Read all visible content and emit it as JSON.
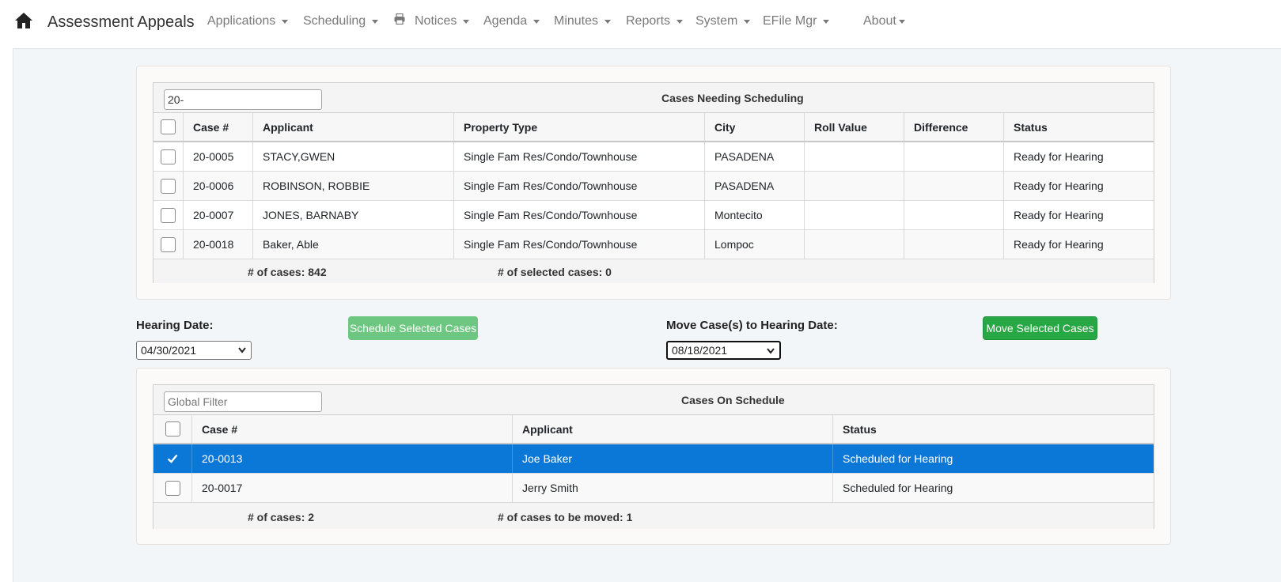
{
  "navbar": {
    "brand": "Assessment Appeals",
    "items": [
      {
        "label": "Applications"
      },
      {
        "label": "Scheduling"
      },
      {
        "label": "Notices"
      },
      {
        "label": "Agenda"
      },
      {
        "label": "Minutes"
      },
      {
        "label": "Reports"
      },
      {
        "label": "System"
      },
      {
        "label": "EFile Mgr"
      },
      {
        "label": "About"
      }
    ]
  },
  "needing": {
    "filter_value": "20-",
    "caption": "Cases Needing Scheduling",
    "columns": [
      "Case #",
      "Applicant",
      "Property Type",
      "City",
      "Roll Value",
      "Difference",
      "Status"
    ],
    "rows": [
      {
        "case": "20-0005",
        "applicant": "STACY,GWEN",
        "property_type": "Single Fam Res/Condo/Townhouse",
        "city": "PASADENA",
        "roll_value": "",
        "difference": "",
        "status": "Ready for Hearing"
      },
      {
        "case": "20-0006",
        "applicant": "ROBINSON, ROBBIE",
        "property_type": "Single Fam Res/Condo/Townhouse",
        "city": "PASADENA",
        "roll_value": "",
        "difference": "",
        "status": "Ready for Hearing"
      },
      {
        "case": "20-0007",
        "applicant": "JONES, BARNABY",
        "property_type": "Single Fam Res/Condo/Townhouse",
        "city": "Montecito",
        "roll_value": "",
        "difference": "",
        "status": "Ready for Hearing"
      },
      {
        "case": "20-0018",
        "applicant": "Baker, Able",
        "property_type": "Single Fam Res/Condo/Townhouse",
        "city": "Lompoc",
        "roll_value": "",
        "difference": "",
        "status": "Ready for Hearing"
      }
    ],
    "count_label": "# of cases: 842",
    "selected_label": "# of selected cases: 0"
  },
  "controls": {
    "hearing_date_label": "Hearing Date:",
    "hearing_date_value": "04/30/2021",
    "schedule_button": "Schedule Selected Cases",
    "move_label": "Move Case(s) to Hearing Date:",
    "move_date_value": "08/18/2021",
    "move_button": "Move Selected Cases"
  },
  "onschedule": {
    "filter_placeholder": "Global Filter",
    "caption": "Cases On Schedule",
    "columns": [
      "Case #",
      "Applicant",
      "Status"
    ],
    "rows": [
      {
        "case": "20-0013",
        "applicant": "Joe Baker",
        "status": "Scheduled for Hearing",
        "checked": true
      },
      {
        "case": "20-0017",
        "applicant": "Jerry Smith",
        "status": "Scheduled for Hearing",
        "checked": false
      }
    ],
    "count_label": "# of cases: 2",
    "moved_label": "# of cases to be moved: 1"
  },
  "colors": {
    "selected_row": "#0b78d7",
    "button_green": "#28a745",
    "button_green_disabled": "#6dc781"
  },
  "icons": [
    "home-icon",
    "printer-icon",
    "chevron-down-icon",
    "checkmark-icon"
  ]
}
